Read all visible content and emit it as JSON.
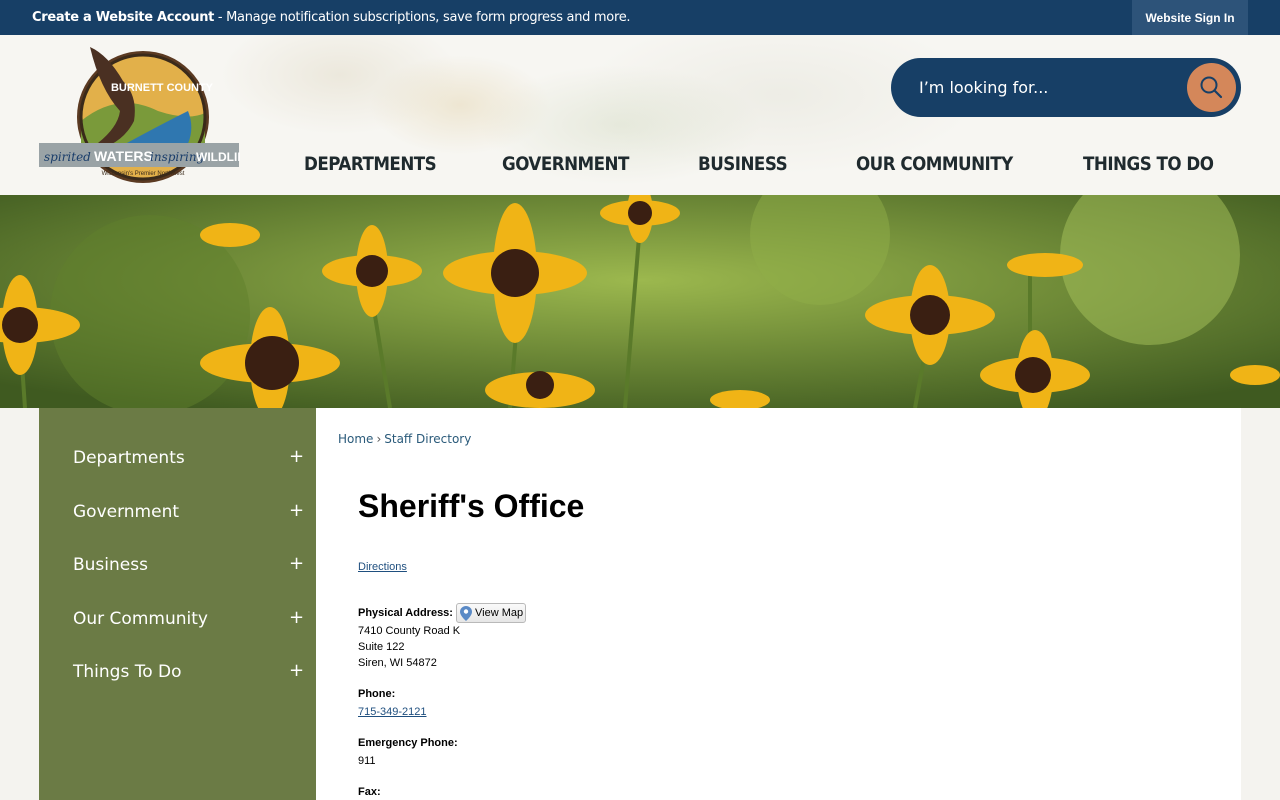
{
  "topbar": {
    "create_account": "Create a Website Account",
    "message": " - Manage notification subscriptions, save form progress and more.",
    "signin": "Website Sign In"
  },
  "logo": {
    "county": "BURNETT COUNTY",
    "tagline_a": "spirited",
    "tagline_b": "WATERS",
    "tagline_c": "inspiring",
    "tagline_d": "WILDLIFE",
    "sub": "Wisconsin's Premier Northwest"
  },
  "search": {
    "placeholder": "I’m looking for..."
  },
  "nav": {
    "departments": "DEPARTMENTS",
    "government": "GOVERNMENT",
    "business": "BUSINESS",
    "community": "OUR COMMUNITY",
    "things": "THINGS TO DO"
  },
  "sidebar": {
    "items": [
      {
        "label": "Departments",
        "toggle": "+"
      },
      {
        "label": "Government",
        "toggle": "+"
      },
      {
        "label": "Business",
        "toggle": "+"
      },
      {
        "label": "Our Community",
        "toggle": "+"
      },
      {
        "label": "Things To Do",
        "toggle": "+"
      }
    ]
  },
  "breadcrumb": {
    "home": "Home",
    "sep": "›",
    "current": "Staff Directory"
  },
  "page": {
    "title": "Sheriff's Office",
    "directions": "Directions",
    "address_label": "Physical Address:",
    "view_map": "View Map",
    "address_line1": "7410 County Road K",
    "address_line2": "Suite 122",
    "address_line3": "Siren, WI 54872",
    "phone_label": "Phone:",
    "phone": "715-349-2121",
    "emergency_label": "Emergency Phone:",
    "emergency": "911",
    "fax_label": "Fax:"
  },
  "colors": {
    "topbar": "#173f66",
    "accent_orange": "#d4875a",
    "sidebar_green": "#6b7b45",
    "link_blue": "#1f4f7f"
  }
}
